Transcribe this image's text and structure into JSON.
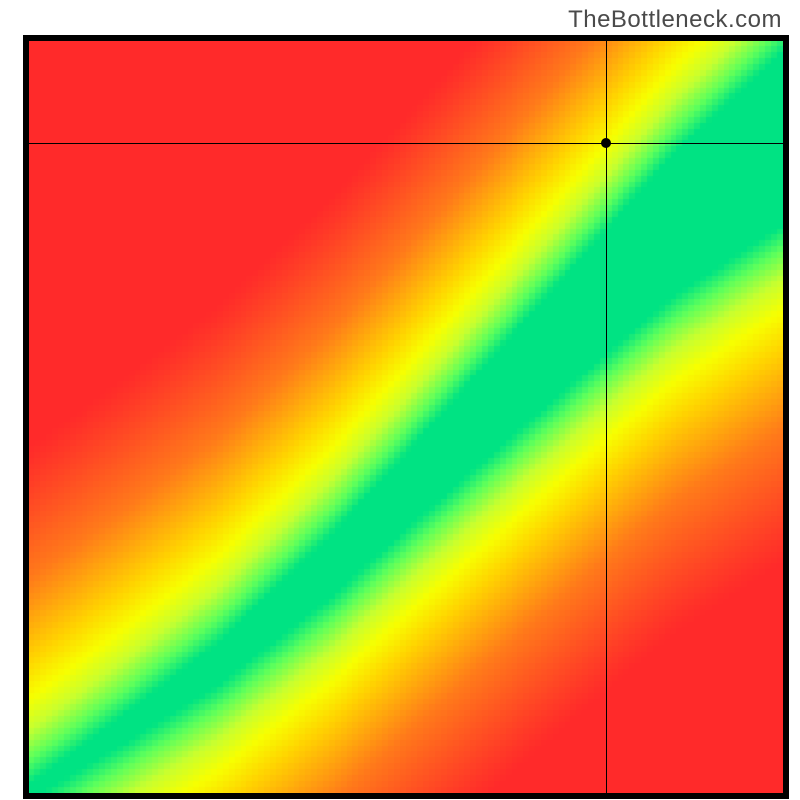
{
  "brand": {
    "watermark": "TheBottleneck.com"
  },
  "chart_data": {
    "type": "heatmap",
    "title": "",
    "xlabel": "",
    "ylabel": "",
    "x_range": [
      0,
      1
    ],
    "y_range": [
      0,
      1
    ],
    "legend": "none",
    "marker": {
      "x": 0.765,
      "y": 0.865
    },
    "field": {
      "description": "Pixelated smooth gradient field. Red at top-left and bottom-right, yellow mid, diagonal green optimal band running bottom-left to upper-right. Band narrows near origin and fans wider toward top-right.",
      "pixelation_cells": 128,
      "color_stops": [
        {
          "t": 0.0,
          "hex": "#ff2a2a"
        },
        {
          "t": 0.35,
          "hex": "#ff7a1a"
        },
        {
          "t": 0.6,
          "hex": "#ffd400"
        },
        {
          "t": 0.72,
          "hex": "#f7ff00"
        },
        {
          "t": 0.82,
          "hex": "#c8ff2f"
        },
        {
          "t": 0.92,
          "hex": "#5cff5c"
        },
        {
          "t": 1.0,
          "hex": "#00e383"
        }
      ],
      "band_centerline": [
        {
          "x": 0.0,
          "y": 0.0
        },
        {
          "x": 0.12,
          "y": 0.08
        },
        {
          "x": 0.25,
          "y": 0.17
        },
        {
          "x": 0.4,
          "y": 0.3
        },
        {
          "x": 0.55,
          "y": 0.45
        },
        {
          "x": 0.7,
          "y": 0.6
        },
        {
          "x": 0.85,
          "y": 0.75
        },
        {
          "x": 1.0,
          "y": 0.87
        }
      ],
      "band_halfwidth": [
        {
          "x": 0.0,
          "w": 0.01
        },
        {
          "x": 0.25,
          "w": 0.028
        },
        {
          "x": 0.5,
          "w": 0.05
        },
        {
          "x": 0.75,
          "w": 0.08
        },
        {
          "x": 1.0,
          "w": 0.115
        }
      ]
    }
  }
}
